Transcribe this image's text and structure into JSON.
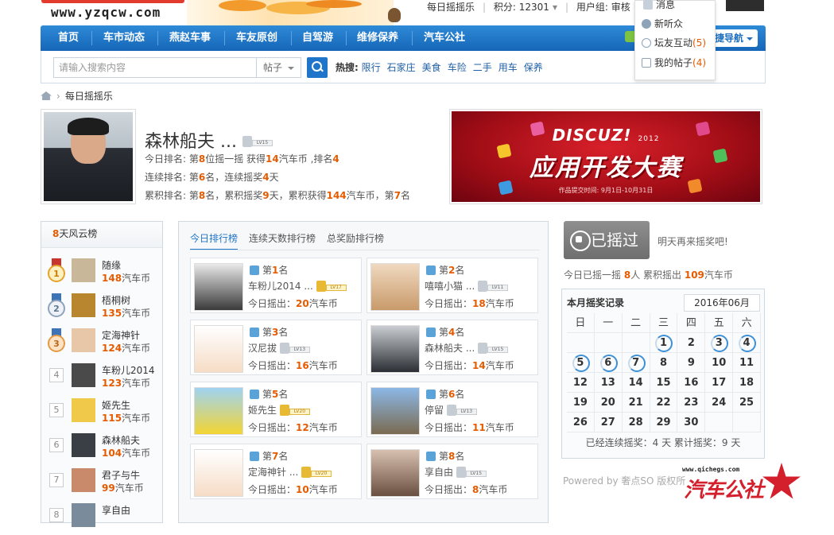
{
  "header": {
    "site_url": "www.yzqcw.com",
    "daily_shake": "每日摇摇乐",
    "points_label": "积分: 12301",
    "user_group_label": "用户组: 审核员",
    "user_group_short": "用户组: 审核"
  },
  "nav": {
    "items": [
      "首页",
      "车市动态",
      "燕赵车事",
      "车友原创",
      "自驾游",
      "维修保养",
      "汽车公社"
    ],
    "quick_nav": "捷导航"
  },
  "user_menu": {
    "items": [
      {
        "label": "消息",
        "count": ""
      },
      {
        "label": "新听众",
        "count": ""
      },
      {
        "label": "坛友互动",
        "count": "(5)"
      },
      {
        "label": "我的帖子",
        "count": "(4)"
      }
    ]
  },
  "search": {
    "placeholder": "请输入搜索内容",
    "type": "帖子",
    "hot_label": "热搜:",
    "hot": [
      "限行",
      "石家庄",
      "美食",
      "车险",
      "二手",
      "用车",
      "保养"
    ]
  },
  "breadcrumb": {
    "current": "每日摇摇乐"
  },
  "profile": {
    "name": "森林船夫 ...",
    "level": "LV15",
    "line1": {
      "a": "今日排名: 第",
      "rank": "8",
      "b": "位摇一摇 获得",
      "coins": "14",
      "c": "汽车币 ,排名",
      "pos": "4"
    },
    "line2": {
      "a": "连续排名: 第",
      "rank": "6",
      "b": "名，连续摇奖",
      "days": "4",
      "c": "天"
    },
    "line3": {
      "a": "累积排名: 第",
      "rank": "8",
      "b": "名，累积摇奖",
      "days": "9",
      "c": "天，累积获得",
      "coins": "144",
      "d": "汽车币，第",
      "pos": "7",
      "e": "名"
    }
  },
  "banner": {
    "brand": "DISCUZ!",
    "year": "2012",
    "title": "应用开发大赛",
    "subtitle": "作品提交时间: 9月1日-10月31日"
  },
  "sidebar": {
    "days": "8",
    "title": "天风云榜",
    "unit": "汽车币",
    "items": [
      {
        "rank": "1",
        "name": "随缘",
        "coins": "148",
        "medal": "gold"
      },
      {
        "rank": "2",
        "name": "梧桐树",
        "coins": "135",
        "medal": "silver"
      },
      {
        "rank": "3",
        "name": "定海神针",
        "coins": "124",
        "medal": "bronze"
      },
      {
        "rank": "4",
        "name": "车粉儿2014",
        "coins": "123",
        "medal": ""
      },
      {
        "rank": "5",
        "name": "姬先生",
        "coins": "115",
        "medal": ""
      },
      {
        "rank": "6",
        "name": "森林船夫",
        "coins": "104",
        "medal": ""
      },
      {
        "rank": "7",
        "name": "君子与牛",
        "coins": "99",
        "medal": ""
      },
      {
        "rank": "8",
        "name": "享自由",
        "coins": "",
        "medal": ""
      }
    ]
  },
  "ranking": {
    "tabs": [
      "今日排行榜",
      "连续天数排行榜",
      "总奖励排行榜"
    ],
    "rank_prefix": "第",
    "rank_suffix": "名",
    "get_label": "今日摇出：",
    "unit": "汽车币",
    "cards": [
      {
        "rank": "1",
        "name": "车粉儿2014 ...",
        "level": "LV17",
        "coins": "20"
      },
      {
        "rank": "2",
        "name": "嘻嘻小猫 ...",
        "level": "LV11",
        "coins": "18"
      },
      {
        "rank": "3",
        "name": "汉尼拔",
        "level": "LV13",
        "coins": "16"
      },
      {
        "rank": "4",
        "name": "森林船夫 ...",
        "level": "LV15",
        "coins": "14"
      },
      {
        "rank": "5",
        "name": "姬先生",
        "level": "LV20",
        "coins": "12"
      },
      {
        "rank": "6",
        "name": "停留",
        "level": "LV13",
        "coins": "11"
      },
      {
        "rank": "7",
        "name": "定海神针 ...",
        "level": "LV20",
        "coins": "10"
      },
      {
        "rank": "8",
        "name": "享自由",
        "level": "LV15",
        "coins": "8"
      }
    ]
  },
  "right": {
    "shaken_label": "已摇过",
    "tomorrow": "明天再来摇奖吧!",
    "today": {
      "a": "今日已摇一摇",
      "people": "8",
      "b": "人 累积摇出",
      "coins": "109",
      "c": "汽车币"
    },
    "calendar": {
      "title": "本月摇奖记录",
      "month": "2016年06月",
      "weekdays": [
        "日",
        "一",
        "二",
        "三",
        "四",
        "五",
        "六"
      ],
      "leading_blanks": 3,
      "days": 30,
      "marked": [
        1,
        3,
        4,
        5,
        6,
        7
      ],
      "footer": "已经连续摇奖：4 天 累计摇奖：9 天"
    },
    "powered": "Powered by 奢点SO 版权所"
  },
  "watermark": {
    "url": "www.qichegs.com",
    "text": "汽车公社"
  },
  "colors": {
    "nav": "#1f75c9",
    "accent": "#e65a00",
    "link": "#1f5fa6"
  }
}
